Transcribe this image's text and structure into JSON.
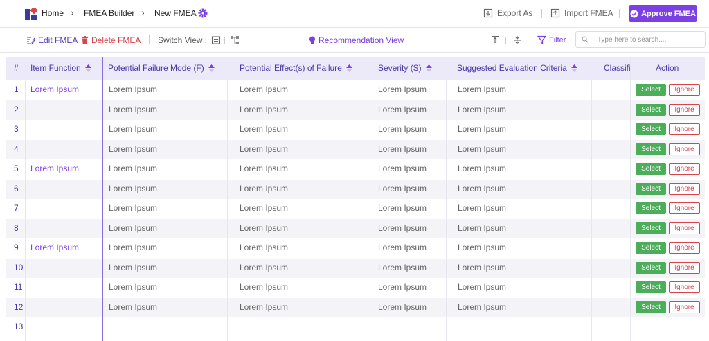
{
  "breadcrumb": {
    "home": "Home",
    "builder": "FMEA Builder",
    "current": "New FMEA"
  },
  "top_actions": {
    "export": "Export As",
    "import": "Import FMEA",
    "approve": "Approve FMEA"
  },
  "toolbar": {
    "edit": "Edit FMEA",
    "delete": "Delete FMEA",
    "switch_view": "Switch View :",
    "recommendation": "Recommendation View",
    "filter": "Filter",
    "search_placeholder": "Type here to search...."
  },
  "table": {
    "headers": {
      "num": "#",
      "item_function": "Item Function",
      "failure_mode": "Potential Failure Mode (F)",
      "effect": "Potential Effect(s) of Failure",
      "severity": "Severity (S)",
      "criteria": "Suggested Evaluation Criteria",
      "classification": "Classifi",
      "action": "Action"
    },
    "select_label": "Select",
    "ignore_label": "Ignore",
    "rows": [
      {
        "num": "1",
        "func": "Lorem Ipsum",
        "mode": "Lorem Ipsum",
        "effect": "Lorem Ipsum",
        "sev": "Lorem Ipsum",
        "crit": "Lorem Ipsum"
      },
      {
        "num": "2",
        "func": "",
        "mode": "Lorem Ipsum",
        "effect": "Lorem Ipsum",
        "sev": "Lorem Ipsum",
        "crit": "Lorem Ipsum"
      },
      {
        "num": "3",
        "func": "",
        "mode": "Lorem Ipsum",
        "effect": "Lorem Ipsum",
        "sev": "Lorem Ipsum",
        "crit": "Lorem Ipsum"
      },
      {
        "num": "4",
        "func": "",
        "mode": "Lorem Ipsum",
        "effect": "Lorem Ipsum",
        "sev": "Lorem Ipsum",
        "crit": "Lorem Ipsum"
      },
      {
        "num": "5",
        "func": "Lorem Ipsum",
        "mode": "Lorem Ipsum",
        "effect": "Lorem Ipsum",
        "sev": "Lorem Ipsum",
        "crit": "Lorem Ipsum"
      },
      {
        "num": "6",
        "func": "",
        "mode": "Lorem Ipsum",
        "effect": "Lorem Ipsum",
        "sev": "Lorem Ipsum",
        "crit": "Lorem Ipsum"
      },
      {
        "num": "7",
        "func": "",
        "mode": "Lorem Ipsum",
        "effect": "Lorem Ipsum",
        "sev": "Lorem Ipsum",
        "crit": "Lorem Ipsum"
      },
      {
        "num": "8",
        "func": "",
        "mode": "Lorem Ipsum",
        "effect": "Lorem Ipsum",
        "sev": "Lorem Ipsum",
        "crit": "Lorem Ipsum"
      },
      {
        "num": "9",
        "func": "Lorem Ipsum",
        "mode": "Lorem Ipsum",
        "effect": "Lorem Ipsum",
        "sev": "Lorem Ipsum",
        "crit": "Lorem Ipsum"
      },
      {
        "num": "10",
        "func": "",
        "mode": "Lorem Ipsum",
        "effect": "Lorem Ipsum",
        "sev": "Lorem Ipsum",
        "crit": "Lorem Ipsum"
      },
      {
        "num": "11",
        "func": "",
        "mode": "Lorem Ipsum",
        "effect": "Lorem Ipsum",
        "sev": "Lorem Ipsum",
        "crit": "Lorem Ipsum"
      },
      {
        "num": "12",
        "func": "",
        "mode": "Lorem Ipsum",
        "effect": "Lorem Ipsum",
        "sev": "Lorem Ipsum",
        "crit": "Lorem Ipsum"
      },
      {
        "num": "13",
        "func": "",
        "mode": "",
        "effect": "",
        "sev": "",
        "crit": ""
      }
    ]
  },
  "colors": {
    "accent": "#7b3fe4",
    "header_bg": "#eceaf9",
    "select_green": "#4cae5a",
    "ignore_red": "#d9434a"
  }
}
